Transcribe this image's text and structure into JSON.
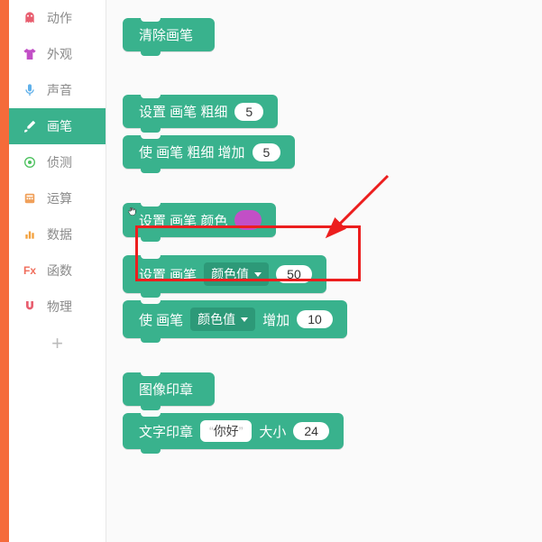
{
  "sidebar": {
    "items": [
      {
        "label": "动作",
        "icon": "ghost",
        "color": "#e85e6f"
      },
      {
        "label": "外观",
        "icon": "shirt",
        "color": "#c24fc6"
      },
      {
        "label": "声音",
        "icon": "mic",
        "color": "#5fb0ea"
      },
      {
        "label": "画笔",
        "icon": "brush",
        "color": "#ffffff"
      },
      {
        "label": "侦测",
        "icon": "target",
        "color": "#4cc15e"
      },
      {
        "label": "运算",
        "icon": "calc",
        "color": "#f0a05a"
      },
      {
        "label": "数据",
        "icon": "bars",
        "color": "#f3a13e"
      },
      {
        "label": "函数",
        "icon": "fx",
        "color": "#f06d5b"
      },
      {
        "label": "物理",
        "icon": "magnet",
        "color": "#e85e6f"
      }
    ],
    "active_index": 3,
    "add_label": "+"
  },
  "blocks": {
    "clear_pen": "清除画笔",
    "set_thickness_prefix": "设置 画笔 粗细",
    "set_thickness_value": "5",
    "change_thickness_prefix": "使 画笔 粗细 增加",
    "change_thickness_value": "5",
    "set_color_prefix": "设置 画笔 颜色",
    "set_color_swatch": "#c24fc6",
    "set_param_prefix": "设置 画笔",
    "param_dropdown": "颜色值",
    "set_param_value": "50",
    "change_param_prefix": "使 画笔",
    "change_param_suffix": "增加",
    "change_param_value": "10",
    "stamp_image": "图像印章",
    "stamp_text_prefix": "文字印章",
    "stamp_text_value": "你好",
    "stamp_text_size_label": "大小",
    "stamp_text_size_value": "24"
  }
}
